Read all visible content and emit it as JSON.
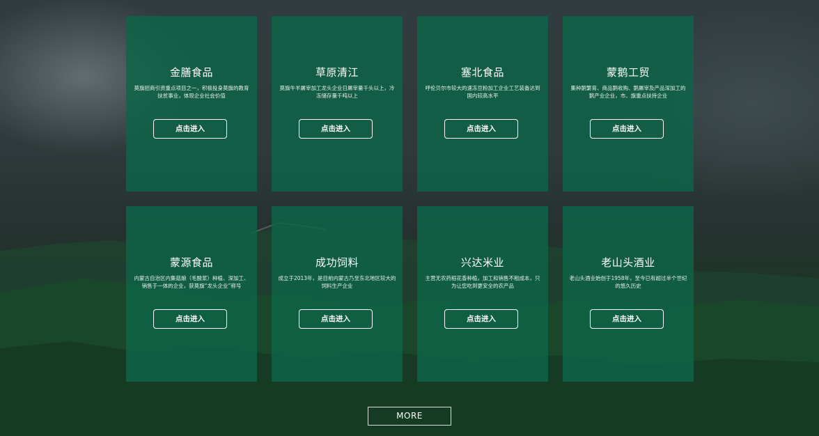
{
  "cards": [
    {
      "title": "金膳食品",
      "desc": "莫旗招商引资重点项目之一，积极投身莫旗的教育扶贫事业，体现企业社会价值",
      "button": "点击进入"
    },
    {
      "title": "草原清江",
      "desc": "莫旗牛羊屠宰加工龙头企业日屠宰量千头以上，冷冻储存量千吨以上",
      "button": "点击进入"
    },
    {
      "title": "塞北食品",
      "desc": "呼伦贝尔市较大的速冻豆粉加工企业工艺装备达到国内较高水平",
      "button": "点击进入"
    },
    {
      "title": "蒙鹅工贸",
      "desc": "集种鹅繁育、商品鹅收购、鹅屠宰及产品深加工的鹅产业企业，市、旗重点扶持企业",
      "button": "点击进入"
    },
    {
      "title": "蒙源食品",
      "desc": "内蒙古自治区内集菇娘（毛酸浆）种植、深加工、销售于一体的企业，获莫旗“龙头企业”称号",
      "button": "点击进入"
    },
    {
      "title": "成功饲料",
      "desc": "成立于2013年，是目前内蒙古乃至东北地区较大的饲料生产企业",
      "button": "点击进入"
    },
    {
      "title": "兴达米业",
      "desc": "主营无农药稻花香种植，加工和销售不租成本，只为让您吃到更安全的农产品",
      "button": "点击进入"
    },
    {
      "title": "老山头酒业",
      "desc": "老山头酒业始创于1958年，至今已有超过半个世纪的悠久历史",
      "button": "点击进入"
    }
  ],
  "more_label": "MORE",
  "colors": {
    "card_bg": "#0e6448",
    "text": "#ffffff"
  }
}
